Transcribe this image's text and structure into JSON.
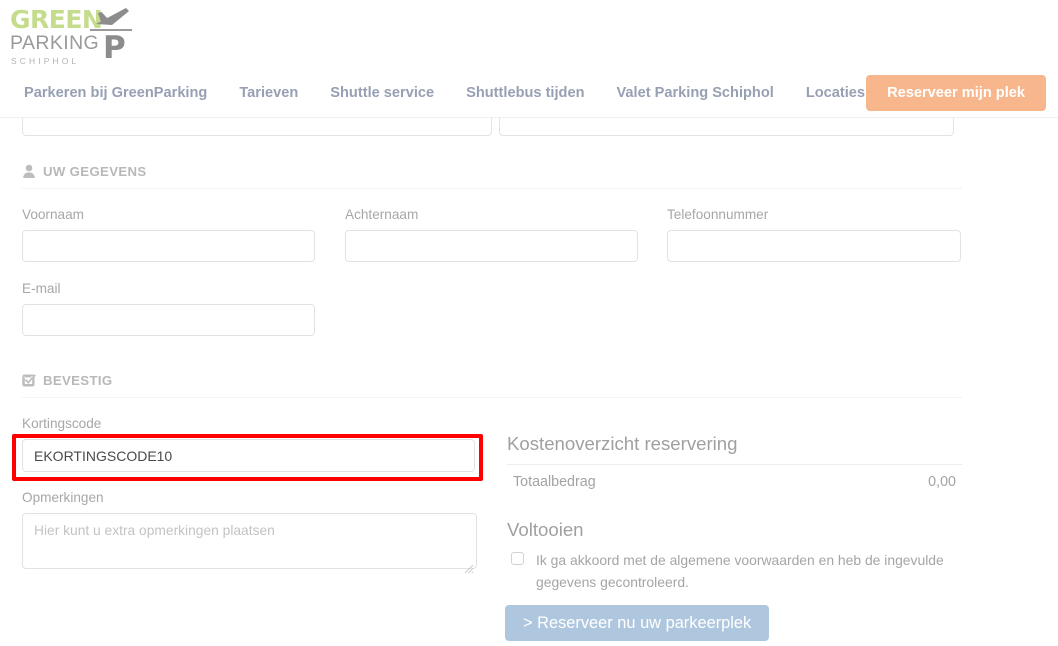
{
  "header": {
    "logo": {
      "line1": "GREEN",
      "line2": "PARKING",
      "line3": "SCHIPHOL",
      "mark_letter": "P",
      "green_hex": "#c5dc8c",
      "gray_hex": "#8c8c8c"
    },
    "nav_items": [
      {
        "label": "Parkeren bij GreenParking",
        "name": "nav-parkeren-bij-greenparking"
      },
      {
        "label": "Tarieven",
        "name": "nav-tarieven"
      },
      {
        "label": "Shuttle service",
        "name": "nav-shuttle-service"
      },
      {
        "label": "Shuttlebus tijden",
        "name": "nav-shuttlebus-tijden"
      },
      {
        "label": "Valet Parking Schiphol",
        "name": "nav-valet-parking-schiphol"
      },
      {
        "label": "Locaties",
        "name": "nav-locaties"
      }
    ],
    "cta_label": "Reserveer mijn plek",
    "cta_hex": "#f7b68b",
    "nav_text_hex": "#97a0b3"
  },
  "sections": {
    "details": {
      "title": "UW GEGEVENS",
      "icon": "person-icon",
      "fields": {
        "voornaam": {
          "label": "Voornaam",
          "value": "",
          "placeholder": ""
        },
        "achternaam": {
          "label": "Achternaam",
          "value": "",
          "placeholder": ""
        },
        "telefoonnummer": {
          "label": "Telefoonnummer",
          "value": "",
          "placeholder": ""
        },
        "email": {
          "label": "E-mail",
          "value": "",
          "placeholder": ""
        }
      }
    },
    "confirm": {
      "title": "BEVESTIG",
      "icon": "checkbox-checked-icon",
      "fields": {
        "kortingscode": {
          "label": "Kortingscode",
          "value": "EKORTINGSCODE10",
          "placeholder": "",
          "highlight_hex": "#fe0000"
        },
        "opmerkingen": {
          "label": "Opmerkingen",
          "value": "",
          "placeholder": "Hier kunt u extra opmerkingen plaatsen"
        }
      }
    }
  },
  "summary": {
    "title": "Kostenoverzicht reservering",
    "rows": [
      {
        "label": "Totaalbedrag",
        "value": "0,00"
      }
    ]
  },
  "complete": {
    "title": "Voltooien",
    "agree_text": "Ik ga akkoord met de algemene voorwaarden en heb de ingevulde gegevens gecontroleerd.",
    "agree_checked": false,
    "submit_label": "> Reserveer nu uw parkeerplek",
    "submit_hex": "#afc7de"
  }
}
